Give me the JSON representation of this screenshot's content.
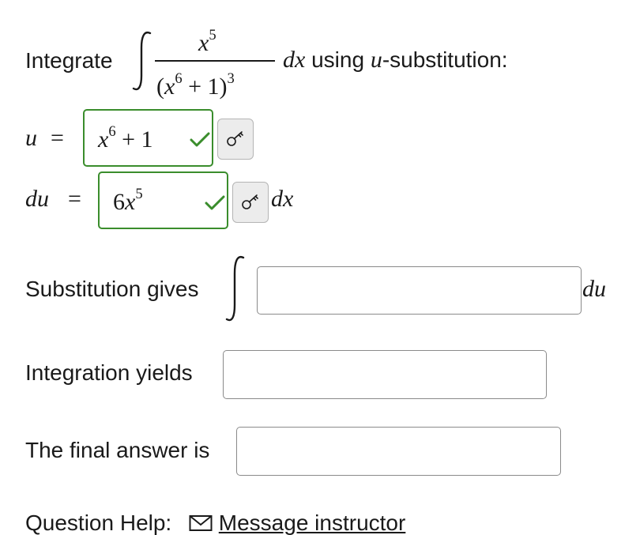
{
  "problem": {
    "prefix": "Integrate",
    "numerator_var": "x",
    "numerator_exp": "5",
    "denominator_open": "(",
    "denominator_var": "x",
    "denominator_inner_exp": "6",
    "denominator_rest": " + 1)",
    "denominator_outer_exp": "3",
    "dx": "dx",
    "middle_text": " using ",
    "u_var": "u",
    "suffix": "-substitution:"
  },
  "u_row": {
    "label": "u",
    "equals": "=",
    "answer_var": "x",
    "answer_exp": "6",
    "answer_rest": " + 1",
    "status": "correct"
  },
  "du_row": {
    "label": "du",
    "equals": "=",
    "answer_coef": "6",
    "answer_var": "x",
    "answer_exp": "5",
    "suffix": "dx",
    "status": "correct"
  },
  "substitution": {
    "label": "Substitution gives",
    "value": "",
    "suffix": "du"
  },
  "integration": {
    "label": "Integration yields",
    "value": ""
  },
  "final": {
    "label": "The final answer is",
    "value": ""
  },
  "help": {
    "label": "Question Help:",
    "link": "Message instructor",
    "icon": "envelope-icon"
  },
  "colors": {
    "correct": "#3a8d2c",
    "text": "#1a1a1a",
    "box_border": "#8a8a8a",
    "button_bg": "#ececec"
  }
}
